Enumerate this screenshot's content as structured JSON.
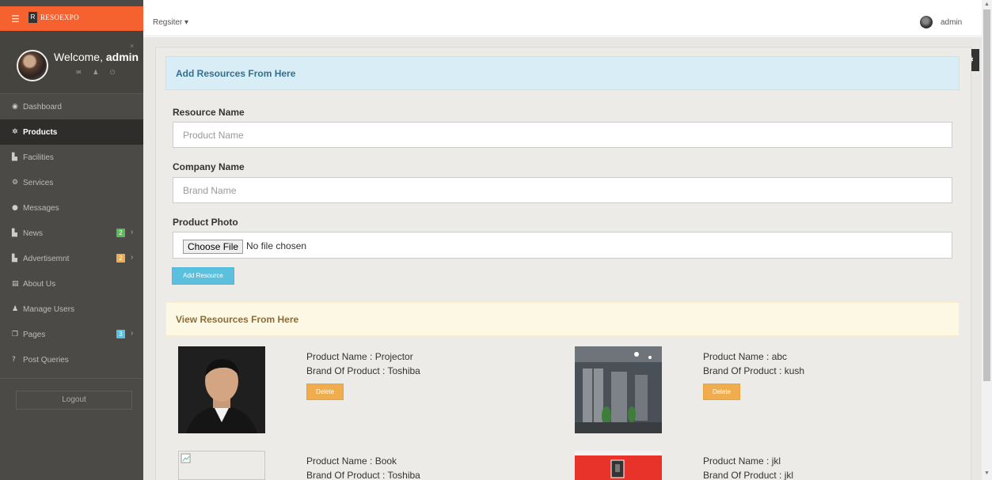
{
  "brand": {
    "name": "RESOEXPO",
    "logo_glyph": "R",
    "menu_icon": "☰",
    "color": "#f5622f"
  },
  "welcome": {
    "prefix": "Welcome, ",
    "user": "admin",
    "close": "×",
    "icons": "✉ ♟ ⏻"
  },
  "sidebar": {
    "items": [
      {
        "label": "Dashboard",
        "icon": "◉",
        "active": false
      },
      {
        "label": "Products",
        "icon": "✲",
        "active": true
      },
      {
        "label": "Facilities",
        "icon": "▙",
        "active": false
      },
      {
        "label": "Services",
        "icon": "⚙",
        "active": false
      },
      {
        "label": "Messages",
        "icon": "●",
        "active": false
      },
      {
        "label": "News",
        "icon": "▙",
        "active": false,
        "badge": "2",
        "badge_color": "#5cb85c"
      },
      {
        "label": "Advertisemnt",
        "icon": "▙",
        "active": false,
        "badge": "2",
        "badge_color": "#f0ad4e"
      },
      {
        "label": "About Us",
        "icon": "▤",
        "active": false
      },
      {
        "label": "Manage Users",
        "icon": "♟",
        "active": false
      },
      {
        "label": "Pages",
        "icon": "❐",
        "active": false,
        "badge": "3",
        "badge_color": "#5bc0de"
      },
      {
        "label": "Post Queries",
        "icon": "?",
        "active": false
      }
    ],
    "chevron": "›",
    "logout_label": "Logout"
  },
  "topbar": {
    "register_label": "Regsiter ▾",
    "admin_label": "admin"
  },
  "settings_icon": "⚙",
  "add_section": {
    "title": "Add Resources From Here",
    "resource_label": "Resource Name",
    "resource_placeholder": "Product Name",
    "company_label": "Company Name",
    "company_placeholder": "Brand Name",
    "photo_label": "Product Photo",
    "choose_file": "Choose File",
    "file_status": "No file chosen",
    "submit_label": "Add Resource"
  },
  "view_section": {
    "title": "View Resources From Here",
    "delete_label": "Delete",
    "resources": [
      {
        "product": "Product Name : Projector",
        "brand": "Brand Of Product : Toshiba"
      },
      {
        "product": "Product Name : abc",
        "brand": "Brand Of Product : kush"
      },
      {
        "product": "Product Name : Book",
        "brand": "Brand Of Product : Toshiba"
      },
      {
        "product": "Product Name : jkl",
        "brand": "Brand Of Product : jkl"
      }
    ]
  },
  "colors": {
    "accent": "#f5622f",
    "info_head": "#d9edf7",
    "warn_head": "#fcf8e3",
    "delete": "#f0ad4e",
    "primary_btn": "#5bc0de"
  }
}
